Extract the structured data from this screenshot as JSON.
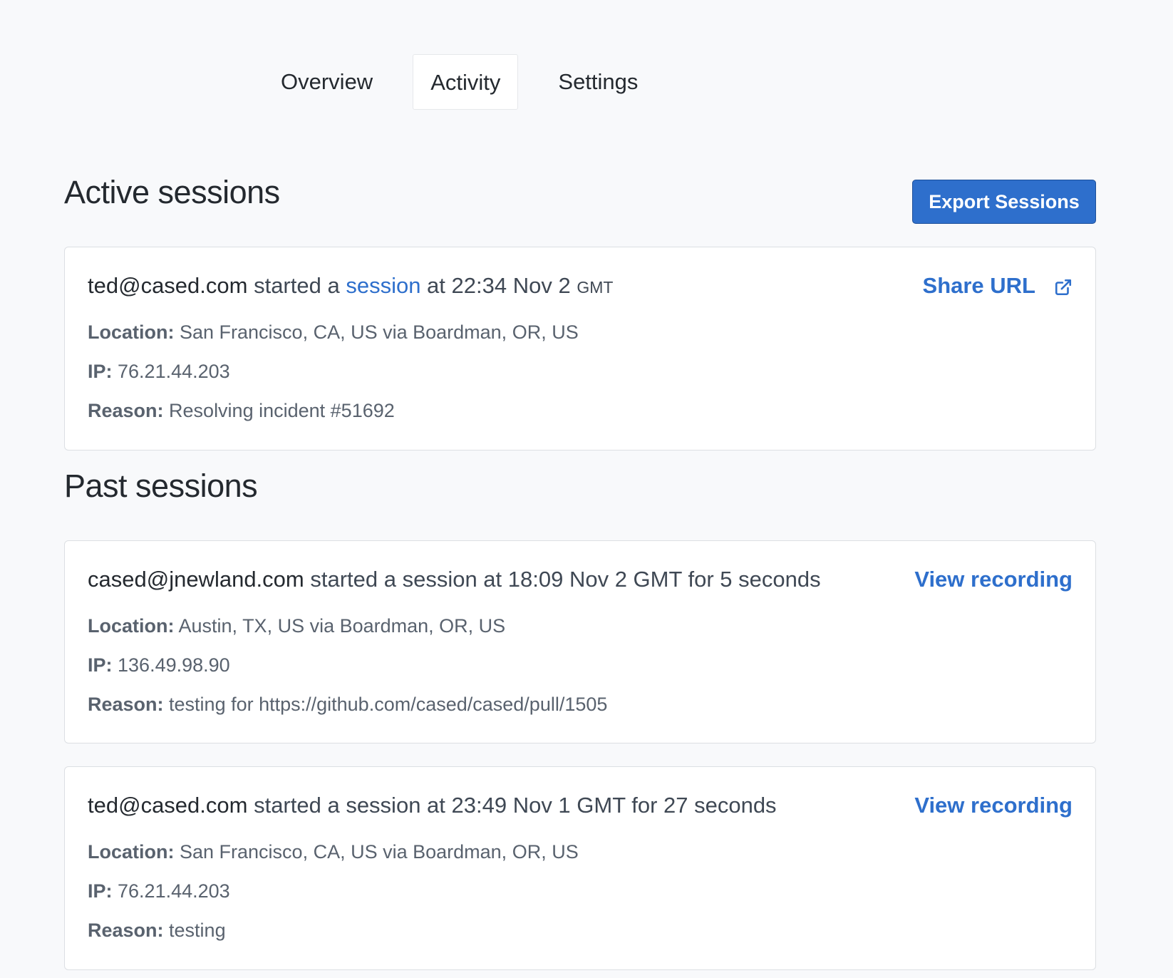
{
  "tabs": [
    {
      "label": "Overview",
      "active": false
    },
    {
      "label": "Activity",
      "active": true
    },
    {
      "label": "Settings",
      "active": false
    }
  ],
  "active_sessions": {
    "title": "Active sessions",
    "export_label": "Export Sessions",
    "items": [
      {
        "user": "ted@cased.com",
        "text_before_link": " started a ",
        "link_text": "session",
        "text_after_link": " at 22:34 Nov 2 ",
        "timezone": "GMT",
        "action_label": "Share URL",
        "action_icon": "external-link-icon",
        "location_label": "Location:",
        "location": " San Francisco, CA, US via Boardman, OR, US",
        "ip_label": "IP:",
        "ip": " 76.21.44.203",
        "reason_label": "Reason:",
        "reason": " Resolving incident #51692"
      }
    ]
  },
  "past_sessions": {
    "title": "Past sessions",
    "items": [
      {
        "user": "cased@jnewland.com",
        "text": " started a session at 18:09 Nov 2 GMT for 5 seconds",
        "action_label": "View recording",
        "location_label": "Location:",
        "location": " Austin, TX, US via Boardman, OR, US",
        "ip_label": "IP:",
        "ip": " 136.49.98.90",
        "reason_label": "Reason:",
        "reason": " testing for https://github.com/cased/cased/pull/1505"
      },
      {
        "user": "ted@cased.com",
        "text": " started a session at 23:49 Nov 1 GMT for 27 seconds",
        "action_label": "View recording",
        "location_label": "Location:",
        "location": " San Francisco, CA, US via Boardman, OR, US",
        "ip_label": "IP:",
        "ip": " 76.21.44.203",
        "reason_label": "Reason:",
        "reason": " testing"
      }
    ]
  },
  "colors": {
    "background": "#f8f9fb",
    "accent": "#2e6fcc",
    "text": "#24292f",
    "muted": "#59626e",
    "border": "#dcdfe3"
  }
}
